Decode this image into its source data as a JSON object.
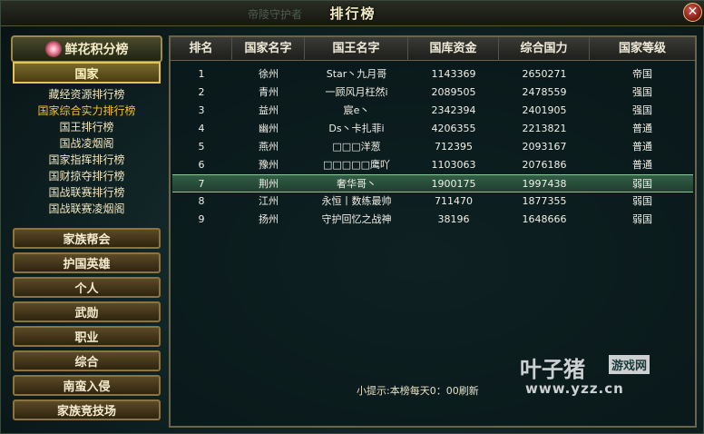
{
  "window": {
    "title": "排行榜",
    "bg_caption": "帝陵守护者",
    "close_label": "✕"
  },
  "sidebar": {
    "header": "鲜花积分榜",
    "active_tab": "国家",
    "sub_items": [
      "藏经资源排行榜",
      "国家综合实力排行榜",
      "国王排行榜",
      "国战凌烟阁",
      "国家指挥排行榜",
      "国财掠夺排行榜",
      "国战联赛排行榜",
      "国战联赛凌烟阁"
    ],
    "selected_sub": 1,
    "buttons": [
      "家族帮会",
      "护国英雄",
      "个人",
      "武勋",
      "职业",
      "综合",
      "南蛮入侵",
      "家族竞技场"
    ]
  },
  "table": {
    "columns": [
      "排名",
      "国家名字",
      "国王名字",
      "国库资金",
      "综合国力",
      "国家等级"
    ],
    "rows": [
      [
        "1",
        "徐州",
        "Star丶九月哥",
        "1143369",
        "2650271",
        "帝国"
      ],
      [
        "2",
        "青州",
        "一顾风月枉然i",
        "2089505",
        "2478559",
        "强国"
      ],
      [
        "3",
        "益州",
        "宸e丶",
        "2342394",
        "2401905",
        "强国"
      ],
      [
        "4",
        "幽州",
        "Ds丶卡扎菲i",
        "4206355",
        "2213821",
        "普通"
      ],
      [
        "5",
        "燕州",
        "□□□洋葱",
        "712395",
        "2093167",
        "普通"
      ],
      [
        "6",
        "豫州",
        "□□□□□鹰吖",
        "1103063",
        "2076186",
        "普通"
      ],
      [
        "7",
        "荆州",
        "奢华哥丶",
        "1900175",
        "1997438",
        "弱国"
      ],
      [
        "8",
        "江州",
        "永恒丨数练最帅",
        "711470",
        "1877355",
        "弱国"
      ],
      [
        "9",
        "扬州",
        "守护回忆之战神",
        "38196",
        "1648666",
        "弱国"
      ]
    ],
    "highlighted_row": 6
  },
  "tip": "小提示:本榜每天0：00刷新",
  "watermark": {
    "brand": "叶子猪",
    "badge": "游戏网",
    "url": "www.yzz.cn"
  }
}
